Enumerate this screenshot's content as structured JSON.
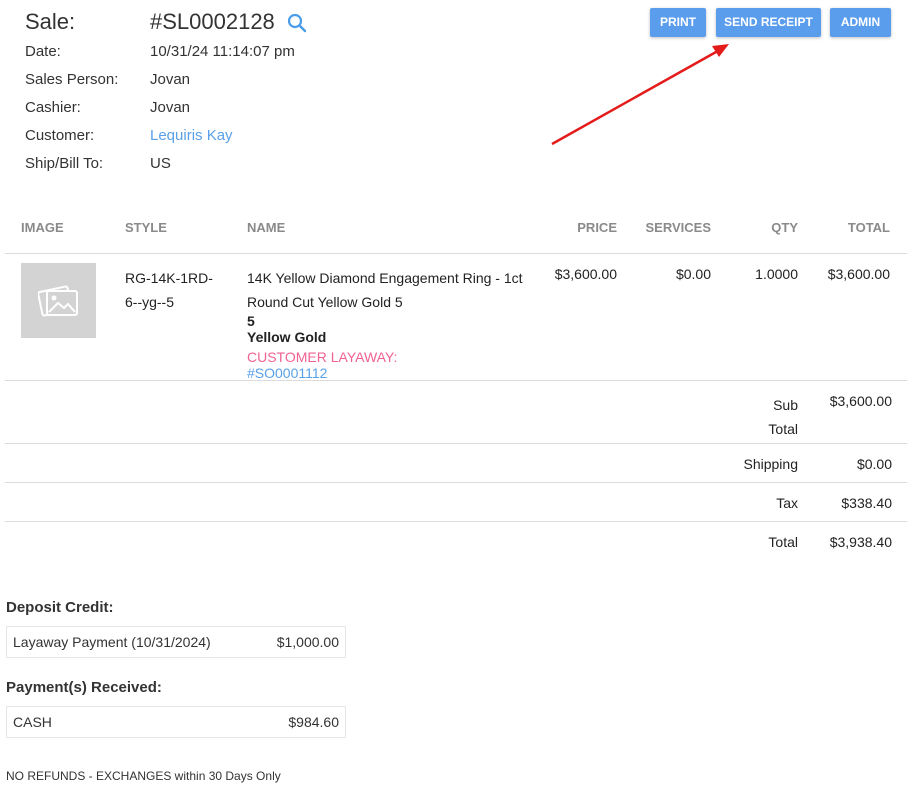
{
  "header": {
    "sale_label": "Sale:",
    "sale_number": "#SL0002128",
    "fields": [
      {
        "label": "Date:",
        "value": "10/31/24 11:14:07 pm"
      },
      {
        "label": "Sales Person:",
        "value": "Jovan"
      },
      {
        "label": "Cashier:",
        "value": "Jovan"
      },
      {
        "label": "Customer:",
        "value": "Lequiris Kay"
      },
      {
        "label": "Ship/Bill To:",
        "value": "US"
      }
    ]
  },
  "buttons": {
    "print": "PRINT",
    "send_receipt": "SEND RECEIPT",
    "admin": "ADMIN"
  },
  "table": {
    "columns": [
      "IMAGE",
      "STYLE",
      "NAME",
      "PRICE",
      "SERVICES",
      "QTY",
      "TOTAL"
    ],
    "row": {
      "style_line1": "RG-14K-1RD-",
      "style_line2": "6--yg--5",
      "name_line1": "14K Yellow Diamond Engagement Ring - 1ct",
      "name_line2": "Round Cut Yellow Gold 5",
      "name_line3": "5",
      "name_line4": "Yellow Gold",
      "layaway_label": "CUSTOMER LAYAWAY:",
      "layaway_link": "#SO0001112",
      "price": "$3,600.00",
      "services": "$0.00",
      "qty": "1.0000",
      "total": "$3,600.00"
    }
  },
  "summary": {
    "sub_total_line1": "Sub",
    "sub_total_line2": "Total",
    "sub_total_value": "$3,600.00",
    "shipping_label": "Shipping",
    "shipping_value": "$0.00",
    "tax_label": "Tax",
    "tax_value": "$338.40",
    "total_label": "Total",
    "total_value": "$3,938.40"
  },
  "deposit": {
    "title": "Deposit Credit:",
    "label": "Layaway Payment (10/31/2024)",
    "value": "$1,000.00"
  },
  "payments": {
    "title": "Payment(s) Received:",
    "label": "CASH",
    "value": "$984.60"
  },
  "footer": {
    "note": "NO REFUNDS - EXCHANGES within 30 Days Only"
  },
  "colors": {
    "button": "#5b9ded",
    "link": "#5aa0e8",
    "layaway": "#f06292",
    "annotation_arrow": "#e41b1b"
  }
}
